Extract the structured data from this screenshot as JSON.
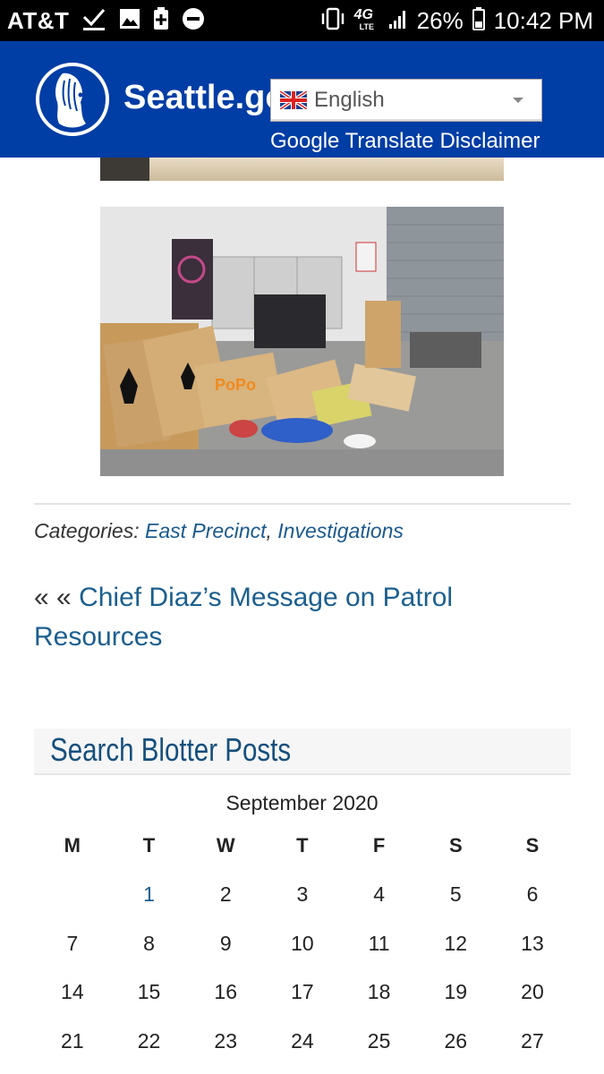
{
  "status_bar": {
    "carrier": "AT&T",
    "network": "4G",
    "network_sub": "LTE",
    "battery": "26%",
    "time": "10:42 PM",
    "icons": [
      "check-icon",
      "image-icon",
      "battery-saver-icon",
      "do-not-disturb-icon",
      "vibrate-icon",
      "signal-icon",
      "battery-icon"
    ]
  },
  "header": {
    "logo_text": "Seattle.gov",
    "translate": {
      "selected": "English",
      "flag": "uk-flag-icon",
      "disclaimer": "Google Translate Disclaimer"
    },
    "colors": {
      "background": "#003da5",
      "text": "#ffffff"
    }
  },
  "post": {
    "categories_label": "Categories:",
    "categories": [
      "East Precinct",
      "Investigations"
    ],
    "category_separator": ",",
    "previous_prefix": "« «",
    "previous_title": "Chief Diaz’s Message on Patrol Resources"
  },
  "calendar_widget": {
    "title": "Search Blotter Posts",
    "month": "September 2020",
    "weekdays": [
      "M",
      "T",
      "W",
      "T",
      "F",
      "S",
      "S"
    ],
    "weeks": [
      [
        "",
        "1",
        "2",
        "3",
        "4",
        "5",
        "6"
      ],
      [
        "7",
        "8",
        "9",
        "10",
        "11",
        "12",
        "13"
      ],
      [
        "14",
        "15",
        "16",
        "17",
        "18",
        "19",
        "20"
      ],
      [
        "21",
        "22",
        "23",
        "24",
        "25",
        "26",
        "27"
      ]
    ],
    "linked_days": [
      "1"
    ],
    "link_color": "#1b5f8f"
  }
}
